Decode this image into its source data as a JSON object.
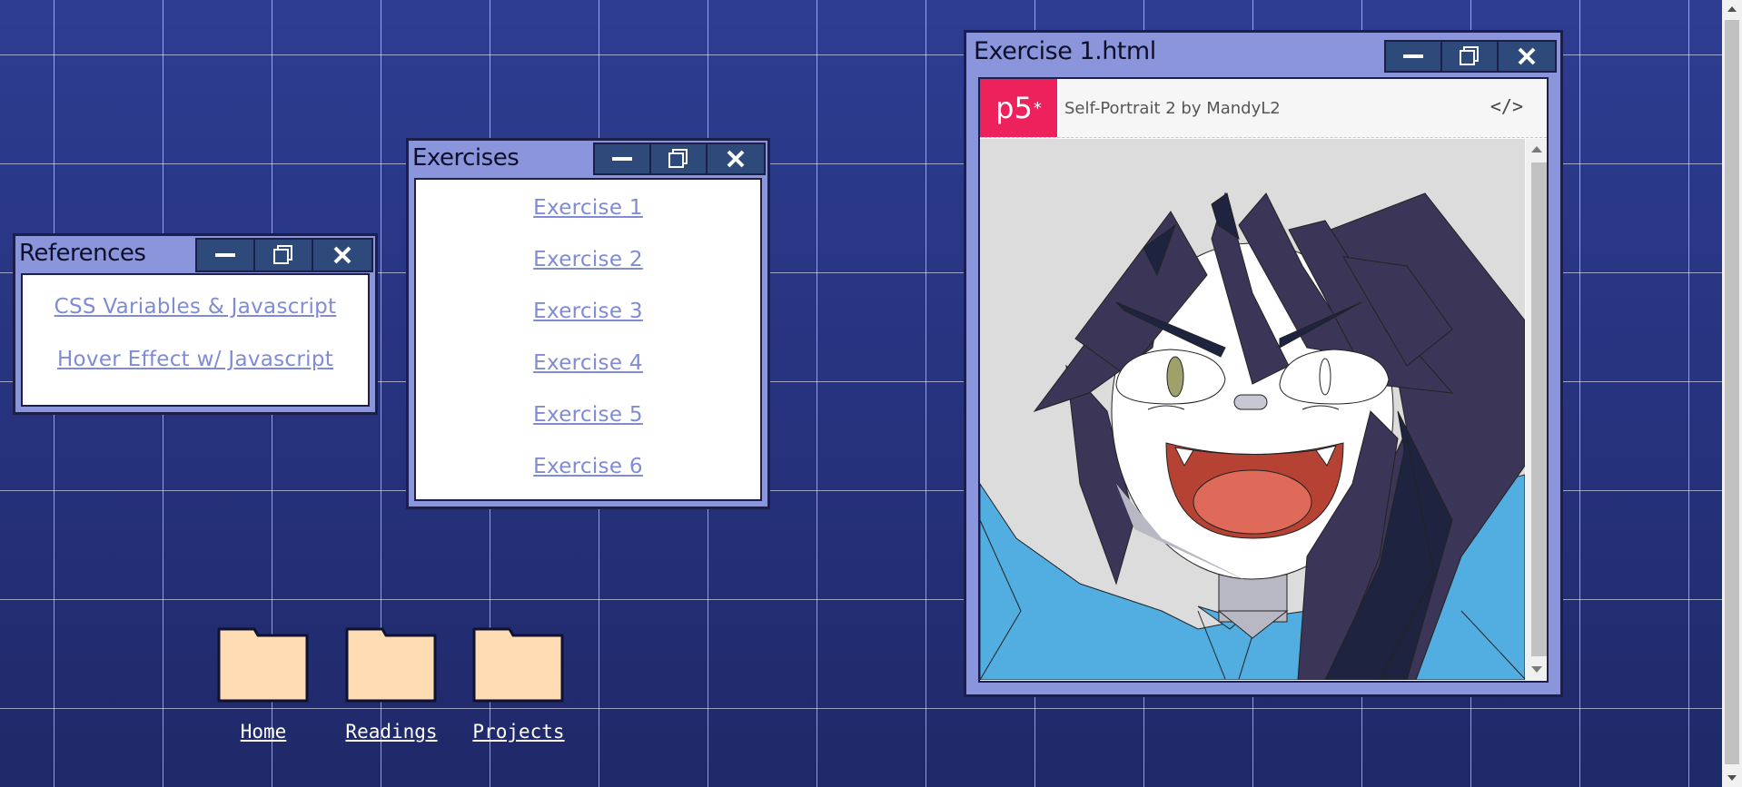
{
  "references_window": {
    "title": "References",
    "links": [
      "CSS Variables & Javascript",
      "Hover Effect w/ Javascript"
    ]
  },
  "exercises_window": {
    "title": "Exercises",
    "links": [
      "Exercise 1",
      "Exercise 2",
      "Exercise 3",
      "Exercise 4",
      "Exercise 5",
      "Exercise 6"
    ]
  },
  "sketch_window": {
    "title": "Exercise 1.html",
    "p5_logo": "p5",
    "p5_logo_mark": "*",
    "sketch_title": "Self-Portrait 2  by  MandyL2",
    "code_icon": "</>"
  },
  "folders": [
    {
      "label": "Home",
      "icon": "folder-icon"
    },
    {
      "label": "Readings",
      "icon": "folder-icon"
    },
    {
      "label": "Projects",
      "icon": "folder-icon"
    }
  ],
  "colors": {
    "desktop": "#2a3680",
    "window_frame": "#8b95dc",
    "window_button": "#2e4a7a",
    "link": "#7f8bd6",
    "folder": "#ffdcb4",
    "p5_brand": "#ed225d"
  }
}
